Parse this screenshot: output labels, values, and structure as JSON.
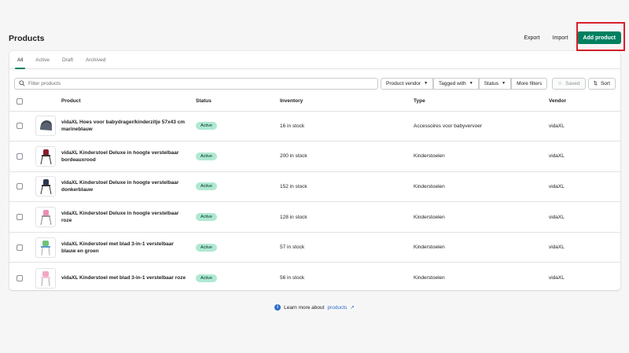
{
  "page": {
    "title": "Products"
  },
  "actions": {
    "export": "Export",
    "import": "Import",
    "add_product": "Add product"
  },
  "tabs": [
    {
      "label": "All",
      "active": true
    },
    {
      "label": "Active",
      "active": false
    },
    {
      "label": "Draft",
      "active": false
    },
    {
      "label": "Archived",
      "active": false
    }
  ],
  "filters": {
    "search_placeholder": "Filter products",
    "product_vendor": "Product vendor",
    "tagged_with": "Tagged with",
    "status": "Status",
    "more_filters": "More filters",
    "saved": "Saved",
    "sort": "Sort"
  },
  "table": {
    "headers": {
      "product": "Product",
      "status": "Status",
      "inventory": "Inventory",
      "type": "Type",
      "vendor": "Vendor"
    },
    "rows": [
      {
        "name": "vidaXL Hoes voor babydrager/kinderzitje 57x43 cm marineblauw",
        "status": "Active",
        "inventory": "16 in stock",
        "type": "Accessoires voor babyvervoer",
        "vendor": "vidaXL",
        "thumb": "car-seat-cover"
      },
      {
        "name": "vidaXL Kinderstoel Deluxe in hoogte verstelbaar bordeauxrood",
        "status": "Active",
        "inventory": "200 in stock",
        "type": "Kinderstoelen",
        "vendor": "vidaXL",
        "thumb": "high-chair-red"
      },
      {
        "name": "vidaXL Kinderstoel Deluxe in hoogte verstelbaar donkerblauw",
        "status": "Active",
        "inventory": "152 in stock",
        "type": "Kinderstoelen",
        "vendor": "vidaXL",
        "thumb": "high-chair-blue"
      },
      {
        "name": "vidaXL Kinderstoel Deluxe in hoogte verstelbaar roze",
        "status": "Active",
        "inventory": "128 in stock",
        "type": "Kinderstoelen",
        "vendor": "vidaXL",
        "thumb": "high-chair-pink"
      },
      {
        "name": "vidaXL Kinderstoel met blad 3-in-1 verstelbaar blauw en groen",
        "status": "Active",
        "inventory": "57 in stock",
        "type": "Kinderstoelen",
        "vendor": "vidaXL",
        "thumb": "high-chair-green"
      },
      {
        "name": "vidaXL Kinderstoel met blad 3-in-1 verstelbaar roze",
        "status": "Active",
        "inventory": "56 in stock",
        "type": "Kinderstoelen",
        "vendor": "vidaXL",
        "thumb": "high-chair-pink-tray"
      }
    ]
  },
  "footer": {
    "prefix": "Learn more about",
    "link": "products"
  },
  "colors": {
    "primary": "#008060",
    "badge": "#aee9d1",
    "highlight": "#d8202c",
    "link": "#2c6ecb"
  }
}
